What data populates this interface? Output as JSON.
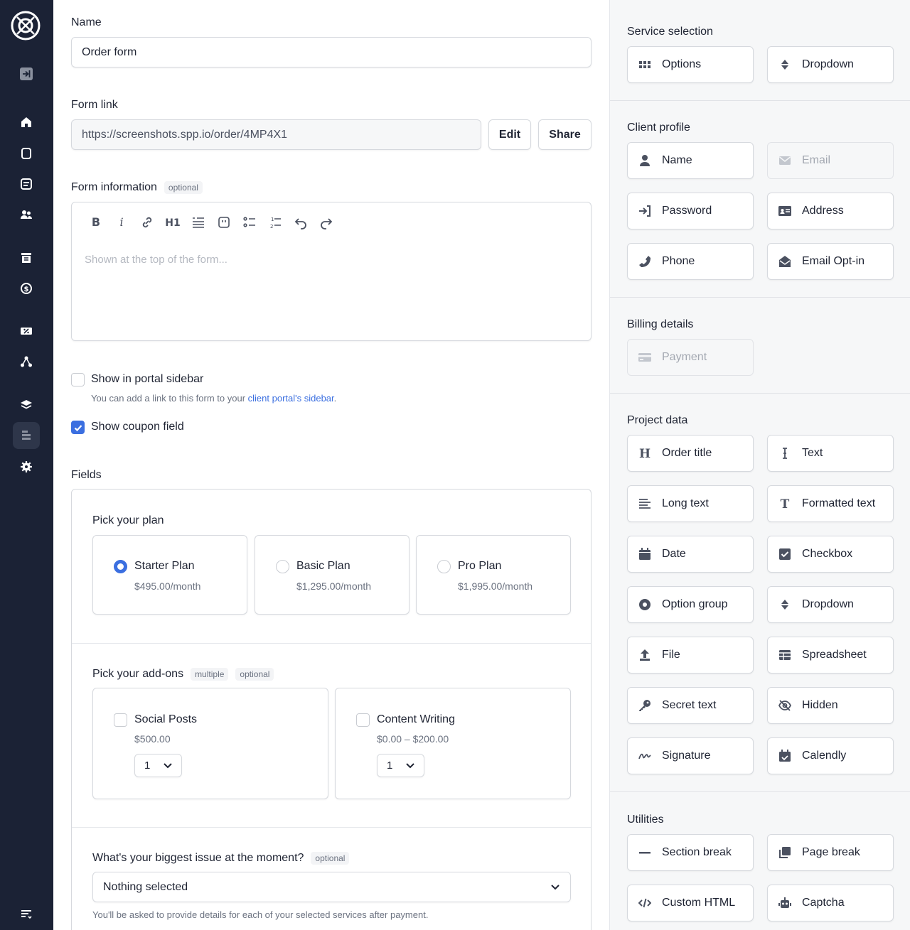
{
  "main": {
    "name_label": "Name",
    "name_value": "Order form",
    "form_link_label": "Form link",
    "form_link_value": "https://screenshots.spp.io/order/4MP4X1",
    "edit_label": "Edit",
    "share_label": "Share",
    "form_info_label": "Form information",
    "optional": "optional",
    "multiple": "multiple",
    "editor_placeholder": "Shown at the top of the form...",
    "show_sidebar_label": "Show in portal sidebar",
    "show_sidebar_checked": false,
    "sidebar_help_prefix": "You can add a link to this form to your ",
    "sidebar_help_link": "client portal's sidebar",
    "sidebar_help_suffix": ".",
    "show_coupon_label": "Show coupon field",
    "show_coupon_checked": true,
    "fields_label": "Fields",
    "plan_question": "Pick your plan",
    "plans": [
      {
        "name": "Starter Plan",
        "price": "$495.00/month",
        "selected": true
      },
      {
        "name": "Basic Plan",
        "price": "$1,295.00/month",
        "selected": false
      },
      {
        "name": "Pro Plan",
        "price": "$1,995.00/month",
        "selected": false
      }
    ],
    "addons_question": "Pick your add-ons",
    "addons": [
      {
        "name": "Social Posts",
        "price": "$500.00",
        "qty": "1"
      },
      {
        "name": "Content Writing",
        "price": "$0.00 – $200.00",
        "qty": "1"
      }
    ],
    "issue_question": "What's your biggest issue at the moment?",
    "issue_value": "Nothing selected",
    "issue_help": "You'll be asked to provide details for each of your selected services after payment."
  },
  "panel": {
    "sections": [
      {
        "title": "Service selection",
        "items": [
          {
            "label": "Options",
            "icon": "grid-icon",
            "disabled": false
          },
          {
            "label": "Dropdown",
            "icon": "sort-icon",
            "disabled": false
          }
        ]
      },
      {
        "title": "Client profile",
        "items": [
          {
            "label": "Name",
            "icon": "user-icon",
            "disabled": false
          },
          {
            "label": "Email",
            "icon": "envelope-icon",
            "disabled": true
          },
          {
            "label": "Password",
            "icon": "sign-in-icon",
            "disabled": false
          },
          {
            "label": "Address",
            "icon": "id-card-icon",
            "disabled": false
          },
          {
            "label": "Phone",
            "icon": "phone-icon",
            "disabled": false
          },
          {
            "label": "Email Opt-in",
            "icon": "envelope-open-icon",
            "disabled": false
          }
        ]
      },
      {
        "title": "Billing details",
        "items": [
          {
            "label": "Payment",
            "icon": "credit-card-icon",
            "disabled": true
          }
        ]
      },
      {
        "title": "Project data",
        "items": [
          {
            "label": "Order title",
            "icon": "heading-icon",
            "disabled": false
          },
          {
            "label": "Text",
            "icon": "text-cursor-icon",
            "disabled": false
          },
          {
            "label": "Long text",
            "icon": "align-left-icon",
            "disabled": false
          },
          {
            "label": "Formatted text",
            "icon": "text-format-icon",
            "disabled": false
          },
          {
            "label": "Date",
            "icon": "calendar-icon",
            "disabled": false
          },
          {
            "label": "Checkbox",
            "icon": "checkbox-icon",
            "disabled": false
          },
          {
            "label": "Option group",
            "icon": "radio-icon",
            "disabled": false
          },
          {
            "label": "Dropdown",
            "icon": "sort-icon",
            "disabled": false
          },
          {
            "label": "File",
            "icon": "upload-icon",
            "disabled": false
          },
          {
            "label": "Spreadsheet",
            "icon": "table-icon",
            "disabled": false
          },
          {
            "label": "Secret text",
            "icon": "key-icon",
            "disabled": false
          },
          {
            "label": "Hidden",
            "icon": "eye-slash-icon",
            "disabled": false
          },
          {
            "label": "Signature",
            "icon": "signature-icon",
            "disabled": false
          },
          {
            "label": "Calendly",
            "icon": "calendar-check-icon",
            "disabled": false
          }
        ]
      },
      {
        "title": "Utilities",
        "items": [
          {
            "label": "Section break",
            "icon": "minus-icon",
            "disabled": false
          },
          {
            "label": "Page break",
            "icon": "copy-icon",
            "disabled": false
          },
          {
            "label": "Custom HTML",
            "icon": "code-icon",
            "disabled": false
          },
          {
            "label": "Captcha",
            "icon": "robot-icon",
            "disabled": false
          }
        ]
      }
    ]
  },
  "colors": {
    "accent": "#3b6fe0",
    "sidebar_bg": "#1b2235",
    "panel_bg": "#f6f7f8"
  }
}
